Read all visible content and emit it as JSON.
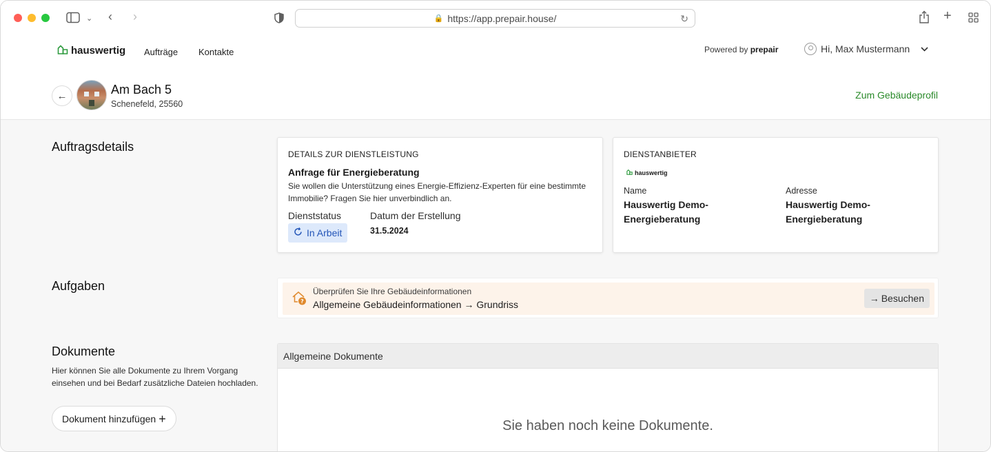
{
  "browser": {
    "url": "https://app.prepair.house/"
  },
  "header": {
    "logo_text": "hauswertig",
    "nav": [
      "Aufträge",
      "Kontakte"
    ],
    "powered_prefix": "Powered by",
    "powered_brand": "prepair",
    "user_greeting": "Hi, Max Mustermann"
  },
  "property": {
    "title": "Am Bach 5",
    "subtitle": "Schenefeld, 25560",
    "profile_link": "Zum Gebäudeprofil"
  },
  "order_details": {
    "section_title": "Auftragsdetails",
    "service": {
      "caption": "DETAILS ZUR DIENSTLEISTUNG",
      "title": "Anfrage für Energieberatung",
      "description": "Sie wollen die Unterstützung eines Energie-Effizienz-Experten für eine bestimmte Immobilie? Fragen Sie hier unverbindlich an.",
      "status_label": "Dienststatus",
      "status_value": "In Arbeit",
      "date_label": "Datum der Erstellung",
      "date_value": "31.5.2024"
    },
    "provider": {
      "caption": "DIENSTANBIETER",
      "logo_text": "hauswertig",
      "name_label": "Name",
      "name_value": "Hauswertig Demo-Energieberatung",
      "address_label": "Adresse",
      "address_value": "Hauswertig Demo-Energieberatung"
    }
  },
  "tasks": {
    "section_title": "Aufgaben",
    "items": [
      {
        "subtitle": "Überprüfen Sie Ihre Gebäudeinformationen",
        "title": "Allgemeine Gebäudeinformationen → Grundriss",
        "action_label": "Besuchen"
      }
    ]
  },
  "documents": {
    "section_title": "Dokumente",
    "description": "Hier können Sie alle Dokumente zu Ihrem Vorgang einsehen und bei Bedarf zusätzliche Dateien hochladen.",
    "add_button": "Dokument hinzufügen",
    "group_title": "Allgemeine Dokumente",
    "empty_text": "Sie haben noch keine Dokumente."
  },
  "colors": {
    "brand_green": "#2e9b3f",
    "link_green": "#2a8a2a",
    "status_bg": "#dde9fb",
    "status_text": "#2456b8",
    "task_bg": "#fdf3ea",
    "task_icon": "#e08a2e"
  }
}
